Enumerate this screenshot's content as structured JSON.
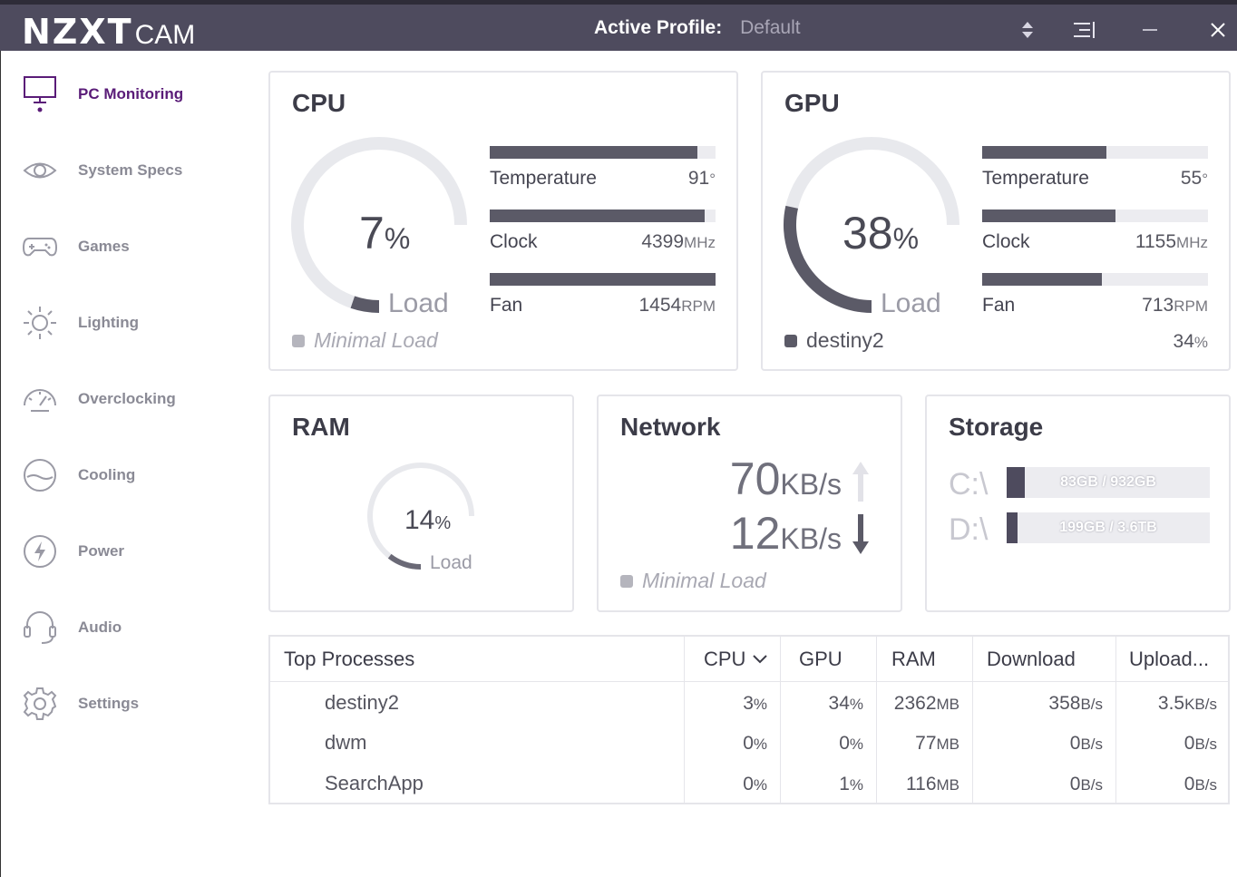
{
  "app": {
    "brand_bold": "NZXT",
    "brand_light": "CAM",
    "profile_label": "Active Profile:",
    "profile_value": "Default"
  },
  "sidebar": {
    "items": [
      {
        "label": "PC Monitoring",
        "icon": "monitor-icon",
        "active": true
      },
      {
        "label": "System Specs",
        "icon": "eye-icon"
      },
      {
        "label": "Games",
        "icon": "gamepad-icon"
      },
      {
        "label": "Lighting",
        "icon": "sun-icon"
      },
      {
        "label": "Overclocking",
        "icon": "speedometer-icon"
      },
      {
        "label": "Cooling",
        "icon": "liquid-icon"
      },
      {
        "label": "Power",
        "icon": "lightning-icon"
      },
      {
        "label": "Audio",
        "icon": "headset-icon"
      },
      {
        "label": "Settings",
        "icon": "gear-icon"
      }
    ]
  },
  "cpu": {
    "title": "CPU",
    "load_value": "7",
    "load_fraction": 0.07,
    "percent_sign": "%",
    "load_label": "Load",
    "legend": "Minimal Load",
    "stats": [
      {
        "label": "Temperature",
        "value": "91",
        "unit": "°",
        "fill": 0.92
      },
      {
        "label": "Clock",
        "value": "4399",
        "unit": "MHz",
        "fill": 0.95
      },
      {
        "label": "Fan",
        "value": "1454",
        "unit": "RPM",
        "fill": 1.0
      }
    ]
  },
  "gpu": {
    "title": "GPU",
    "load_value": "38",
    "load_fraction": 0.38,
    "percent_sign": "%",
    "load_label": "Load",
    "legend": "destiny2",
    "legend_value": "34",
    "legend_unit": "%",
    "stats": [
      {
        "label": "Temperature",
        "value": "55",
        "unit": "°",
        "fill": 0.55
      },
      {
        "label": "Clock",
        "value": "1155",
        "unit": "MHz",
        "fill": 0.59
      },
      {
        "label": "Fan",
        "value": "713",
        "unit": "RPM",
        "fill": 0.53
      }
    ]
  },
  "ram": {
    "title": "RAM",
    "load_value": "14",
    "load_fraction": 0.14,
    "percent_sign": "%",
    "load_label": "Load"
  },
  "network": {
    "title": "Network",
    "upload_value": "70",
    "download_value": "12",
    "unit": "KB/s",
    "legend": "Minimal Load"
  },
  "storage": {
    "title": "Storage",
    "drives": [
      {
        "label": "C:\\",
        "text": "83GB / 932GB",
        "fill": 0.089
      },
      {
        "label": "D:\\",
        "text": "199GB / 3.6TB",
        "fill": 0.054
      }
    ]
  },
  "processes": {
    "headers": [
      "Top Processes",
      "CPU",
      "GPU",
      "RAM",
      "Download",
      "Upload..."
    ],
    "rows": [
      {
        "name": "destiny2",
        "cpu": "3",
        "gpu": "34",
        "ram": "2362",
        "download": "358",
        "upload": "3.5"
      },
      {
        "name": "dwm",
        "cpu": "0",
        "gpu": "0",
        "ram": "77",
        "download": "0",
        "upload": "0"
      },
      {
        "name": "SearchApp",
        "cpu": "0",
        "gpu": "1",
        "ram": "116",
        "download": "0",
        "upload": "0"
      }
    ],
    "units": {
      "cpu": "%",
      "gpu": "%",
      "ram": "MB",
      "download": "B/s",
      "upload_row1": "KB/s",
      "upload": "B/s"
    }
  },
  "colors": {
    "titlebar": "#4e4b5e",
    "accent": "#5a1c78",
    "gauge_track": "#e8e9ed",
    "gauge_fill": "#5b5a67"
  }
}
